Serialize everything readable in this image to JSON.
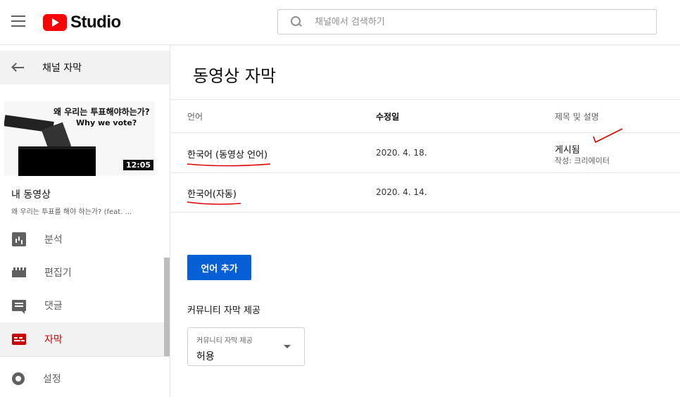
{
  "header": {
    "logo_text": "Studio",
    "search_placeholder": "채널에서 검색하기"
  },
  "sidebar": {
    "back_label": "채널 자막",
    "thumbnail": {
      "title_line1": "왜 우리는 투표해야하는가?",
      "title_line2": "Why we vote?",
      "duration": "12:05"
    },
    "video_section_title": "내 동영상",
    "video_subtitle": "왜 우리는 투표를 해야 하는가? (feat. ...",
    "items": [
      {
        "label": "분석",
        "icon": "analytics-icon"
      },
      {
        "label": "편집기",
        "icon": "editor-icon"
      },
      {
        "label": "댓글",
        "icon": "comments-icon"
      },
      {
        "label": "자막",
        "icon": "subtitles-icon",
        "active": true
      },
      {
        "label": "설정",
        "icon": "gear-icon"
      }
    ]
  },
  "main": {
    "title": "동영상 자막",
    "columns": [
      "언어",
      "수정일",
      "제목 및 설명"
    ],
    "rows": [
      {
        "language": "한국어 (동영상 언어)",
        "date": "2020. 4. 18.",
        "status": "게시됨",
        "status_sub": "작성: 크리에이터"
      },
      {
        "language": "한국어(자동)",
        "date": "2020. 4. 14."
      }
    ],
    "add_language_button": "언어 추가",
    "community_label": "커뮤니티 자막 제공",
    "community_select": {
      "label": "커뮤니티 자막 제공",
      "value": "허용"
    }
  },
  "colors": {
    "brand_red": "#ff0000",
    "active_red": "#cc0000",
    "button_blue": "#065fd4",
    "annotation_red": "#e00000"
  }
}
